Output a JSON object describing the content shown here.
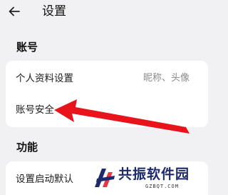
{
  "header": {
    "back_icon": "arrow-left-icon",
    "title": "设置"
  },
  "sections": {
    "account": {
      "title": "账号",
      "items": [
        {
          "label": "个人资料设置",
          "value": "昵称、头像"
        },
        {
          "label": "账号安全"
        }
      ]
    },
    "features": {
      "title": "功能",
      "items": [
        {
          "label": "设置启动默认"
        }
      ]
    }
  },
  "annotation": {
    "type": "red-arrow",
    "color": "#e8141c",
    "points_to": "账号安全"
  },
  "watermark": {
    "brand": "共振软件园",
    "url": "GZBQT.COM",
    "colors": {
      "primary": "#1d2a6e",
      "accent": "#e53945"
    }
  }
}
